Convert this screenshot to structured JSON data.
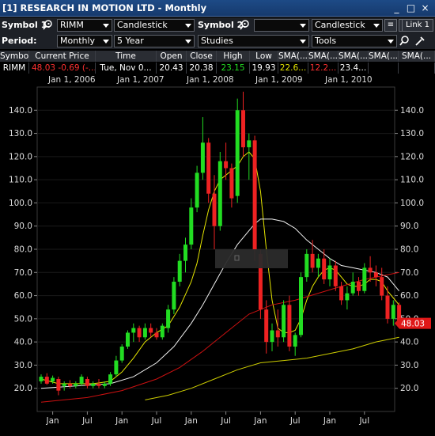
{
  "window": {
    "title": "[1] RESEARCH IN MOTION LTD - Monthly",
    "minimize_icon": "_",
    "restore_icon": "□",
    "close_icon": "×"
  },
  "toolbar": {
    "symbol1_label": "Symbol 1:",
    "symbol1_value": "RIMM",
    "chart_type1": "Candlestick",
    "symbol2_label": "Symbol 2:",
    "symbol2_value": "",
    "chart_type2": "Candlestick",
    "help_label": "?",
    "link_label": "Link 1",
    "period_label": "Period:",
    "period_value": "Monthly",
    "range_value": "5 Year",
    "studies_value": "Studies",
    "tools_value": "Tools"
  },
  "quote_table": {
    "headers": [
      "Symbol",
      "Current Price",
      "Time",
      "Open",
      "Close",
      "High",
      "Low",
      "SMA(...",
      "SMA(...",
      "SMA(...",
      "SMA(...",
      "SMA(..."
    ],
    "row": {
      "symbol": "RIMM",
      "price": "48.03",
      "change": "-0.69",
      "pct": "(-...",
      "time": "Tue, Nov 0...",
      "open": "20.43",
      "close": "20.38",
      "high": "23.15",
      "low": "19.93",
      "sma1": "22.6...",
      "sma2": "12.2...",
      "sma3": "23.4..."
    }
  },
  "colors": {
    "up": "#22dd22",
    "down": "#ee2222",
    "sma_yellow": "#e6e600",
    "sma_white": "#f0f0f0",
    "sma_red": "#cc1111",
    "sma_olive": "#cccc00",
    "price_badge": "#e01818"
  },
  "date_labels": [
    "Jan 1, 2006",
    "Jan 1, 2007",
    "Jan 1, 2008",
    "Jan 1, 2009",
    "Jan 1, 2010"
  ],
  "x_tick_labels": [
    "Jan",
    "Jul",
    "Jan",
    "Jul",
    "Jan",
    "Jul",
    "Jan",
    "Jul",
    "Jan",
    "Jul"
  ],
  "chart_data": {
    "type": "candlestick",
    "period": "Monthly",
    "ylim": [
      10,
      150
    ],
    "y_ticks": [
      20,
      30,
      40,
      50,
      60,
      70,
      80,
      90,
      100,
      110,
      120,
      130,
      140
    ],
    "y_tick_labels": [
      "20.0",
      "30.0",
      "40.0",
      "50.0",
      "60.0",
      "70.0",
      "80.0",
      "90.0",
      "100.0",
      "110.0",
      "120.0",
      "130.0",
      "140.0"
    ],
    "last_price_label": "48.03",
    "last_price": 48.03,
    "start_month": "2005-11",
    "candles": [
      {
        "o": 23.0,
        "h": 26.0,
        "l": 22.0,
        "c": 25.0
      },
      {
        "o": 25.0,
        "h": 26.5,
        "l": 21.5,
        "c": 22.0
      },
      {
        "o": 23.0,
        "h": 25.5,
        "l": 22.0,
        "c": 24.5
      },
      {
        "o": 24.0,
        "h": 25.0,
        "l": 17.0,
        "c": 19.0
      },
      {
        "o": 21.0,
        "h": 23.0,
        "l": 19.0,
        "c": 22.0
      },
      {
        "o": 22.0,
        "h": 23.5,
        "l": 20.0,
        "c": 21.0
      },
      {
        "o": 21.0,
        "h": 23.0,
        "l": 20.0,
        "c": 22.0
      },
      {
        "o": 22.0,
        "h": 26.0,
        "l": 21.0,
        "c": 25.0
      },
      {
        "o": 24.0,
        "h": 25.0,
        "l": 20.0,
        "c": 21.0
      },
      {
        "o": 21.0,
        "h": 23.0,
        "l": 20.0,
        "c": 22.0
      },
      {
        "o": 22.0,
        "h": 24.0,
        "l": 20.0,
        "c": 21.0
      },
      {
        "o": 21.0,
        "h": 23.0,
        "l": 20.0,
        "c": 22.0
      },
      {
        "o": 22.0,
        "h": 27.0,
        "l": 21.0,
        "c": 26.0
      },
      {
        "o": 26.0,
        "h": 34.0,
        "l": 25.0,
        "c": 32.0
      },
      {
        "o": 32.0,
        "h": 39.0,
        "l": 31.0,
        "c": 38.0
      },
      {
        "o": 38.0,
        "h": 45.0,
        "l": 37.0,
        "c": 44.0
      },
      {
        "o": 44.0,
        "h": 48.0,
        "l": 40.0,
        "c": 46.0
      },
      {
        "o": 46.0,
        "h": 47.0,
        "l": 40.0,
        "c": 42.0
      },
      {
        "o": 42.0,
        "h": 48.0,
        "l": 41.0,
        "c": 46.0
      },
      {
        "o": 46.0,
        "h": 48.0,
        "l": 42.0,
        "c": 44.0
      },
      {
        "o": 44.0,
        "h": 46.0,
        "l": 41.0,
        "c": 42.0
      },
      {
        "o": 42.0,
        "h": 48.0,
        "l": 41.0,
        "c": 47.0
      },
      {
        "o": 46.0,
        "h": 56.0,
        "l": 44.0,
        "c": 54.0
      },
      {
        "o": 54.0,
        "h": 68.0,
        "l": 52.0,
        "c": 66.0
      },
      {
        "o": 66.0,
        "h": 78.0,
        "l": 64.0,
        "c": 75.0
      },
      {
        "o": 75.0,
        "h": 85.0,
        "l": 70.0,
        "c": 82.0
      },
      {
        "o": 82.0,
        "h": 102.0,
        "l": 80.0,
        "c": 98.0
      },
      {
        "o": 98.0,
        "h": 116.0,
        "l": 96.0,
        "c": 113.0
      },
      {
        "o": 113.0,
        "h": 137.0,
        "l": 110.0,
        "c": 126.0
      },
      {
        "o": 126.0,
        "h": 128.0,
        "l": 100.0,
        "c": 104.0
      },
      {
        "o": 104.0,
        "h": 112.0,
        "l": 80.0,
        "c": 90.0
      },
      {
        "o": 90.0,
        "h": 122.0,
        "l": 88.0,
        "c": 118.0
      },
      {
        "o": 118.0,
        "h": 126.0,
        "l": 110.0,
        "c": 115.0
      },
      {
        "o": 115.0,
        "h": 117.0,
        "l": 98.0,
        "c": 102.0
      },
      {
        "o": 103.0,
        "h": 145.0,
        "l": 100.0,
        "c": 140.0
      },
      {
        "o": 140.0,
        "h": 148.0,
        "l": 120.0,
        "c": 124.0
      },
      {
        "o": 124.0,
        "h": 130.0,
        "l": 110.0,
        "c": 127.0
      },
      {
        "o": 127.0,
        "h": 129.0,
        "l": 75.0,
        "c": 80.0
      },
      {
        "o": 78.0,
        "h": 80.0,
        "l": 50.0,
        "c": 54.0
      },
      {
        "o": 54.0,
        "h": 58.0,
        "l": 35.0,
        "c": 40.0
      },
      {
        "o": 40.0,
        "h": 48.0,
        "l": 36.0,
        "c": 45.0
      },
      {
        "o": 45.0,
        "h": 54.0,
        "l": 38.0,
        "c": 42.0
      },
      {
        "o": 42.0,
        "h": 58.0,
        "l": 40.0,
        "c": 56.0
      },
      {
        "o": 56.0,
        "h": 60.0,
        "l": 36.0,
        "c": 38.0
      },
      {
        "o": 38.0,
        "h": 44.0,
        "l": 34.0,
        "c": 43.0
      },
      {
        "o": 43.0,
        "h": 70.0,
        "l": 42.0,
        "c": 68.0
      },
      {
        "o": 68.0,
        "h": 80.0,
        "l": 66.0,
        "c": 78.0
      },
      {
        "o": 78.0,
        "h": 84.0,
        "l": 70.0,
        "c": 72.0
      },
      {
        "o": 72.0,
        "h": 78.0,
        "l": 68.0,
        "c": 76.0
      },
      {
        "o": 76.0,
        "h": 80.0,
        "l": 65.0,
        "c": 67.0
      },
      {
        "o": 67.0,
        "h": 76.0,
        "l": 64.0,
        "c": 73.0
      },
      {
        "o": 73.0,
        "h": 75.0,
        "l": 62.0,
        "c": 64.0
      },
      {
        "o": 64.0,
        "h": 66.0,
        "l": 56.0,
        "c": 58.0
      },
      {
        "o": 58.0,
        "h": 64.0,
        "l": 54.0,
        "c": 61.0
      },
      {
        "o": 61.0,
        "h": 70.0,
        "l": 60.0,
        "c": 66.0
      },
      {
        "o": 66.0,
        "h": 68.0,
        "l": 60.0,
        "c": 62.0
      },
      {
        "o": 62.0,
        "h": 74.0,
        "l": 61.0,
        "c": 72.0
      },
      {
        "o": 72.0,
        "h": 77.0,
        "l": 66.0,
        "c": 70.0
      },
      {
        "o": 70.0,
        "h": 73.0,
        "l": 64.0,
        "c": 68.0
      },
      {
        "o": 68.0,
        "h": 72.0,
        "l": 58.0,
        "c": 60.0
      },
      {
        "o": 60.0,
        "h": 64.0,
        "l": 48.0,
        "c": 50.0
      },
      {
        "o": 50.0,
        "h": 58.0,
        "l": 47.0,
        "c": 56.0
      },
      {
        "o": 56.0,
        "h": 57.0,
        "l": 46.0,
        "c": 48.0
      }
    ],
    "sma_series": [
      {
        "color": "#e6e600",
        "points": [
          [
            0,
            24
          ],
          [
            3,
            22
          ],
          [
            6,
            22
          ],
          [
            9,
            22
          ],
          [
            12,
            23
          ],
          [
            14,
            27
          ],
          [
            16,
            33
          ],
          [
            18,
            40
          ],
          [
            20,
            44
          ],
          [
            22,
            47
          ],
          [
            24,
            55
          ],
          [
            26,
            66
          ],
          [
            27,
            74
          ],
          [
            28,
            86
          ],
          [
            29,
            97
          ],
          [
            30,
            105
          ],
          [
            31,
            110
          ],
          [
            32,
            112
          ],
          [
            33,
            114
          ],
          [
            34,
            116
          ],
          [
            35,
            120
          ],
          [
            36,
            122
          ],
          [
            37,
            119
          ],
          [
            38,
            105
          ],
          [
            39,
            80
          ],
          [
            40,
            58
          ],
          [
            41,
            46
          ],
          [
            42,
            44
          ],
          [
            43,
            44
          ],
          [
            44,
            45
          ],
          [
            45,
            50
          ],
          [
            46,
            58
          ],
          [
            47,
            64
          ],
          [
            48,
            68
          ],
          [
            49,
            71
          ],
          [
            50,
            72
          ],
          [
            51,
            71
          ],
          [
            52,
            68
          ],
          [
            53,
            65
          ],
          [
            54,
            64
          ],
          [
            55,
            64
          ],
          [
            56,
            65
          ],
          [
            57,
            67
          ],
          [
            58,
            67
          ],
          [
            59,
            66
          ],
          [
            60,
            62
          ],
          [
            61,
            59
          ],
          [
            62,
            56
          ]
        ]
      },
      {
        "color": "#f0f0f0",
        "points": [
          [
            0,
            20
          ],
          [
            6,
            21
          ],
          [
            12,
            22
          ],
          [
            16,
            25
          ],
          [
            20,
            31
          ],
          [
            23,
            38
          ],
          [
            26,
            48
          ],
          [
            28,
            56
          ],
          [
            30,
            65
          ],
          [
            32,
            74
          ],
          [
            34,
            82
          ],
          [
            36,
            88
          ],
          [
            37,
            91
          ],
          [
            38,
            93
          ],
          [
            40,
            93
          ],
          [
            42,
            92
          ],
          [
            44,
            89
          ],
          [
            46,
            84
          ],
          [
            48,
            80
          ],
          [
            50,
            76
          ],
          [
            52,
            73
          ],
          [
            54,
            72
          ],
          [
            56,
            71
          ],
          [
            58,
            70
          ],
          [
            60,
            68
          ],
          [
            62,
            62
          ]
        ]
      },
      {
        "color": "#cc1111",
        "points": [
          [
            0,
            14
          ],
          [
            8,
            16
          ],
          [
            14,
            19
          ],
          [
            20,
            24
          ],
          [
            24,
            29
          ],
          [
            28,
            36
          ],
          [
            32,
            44
          ],
          [
            36,
            52
          ],
          [
            40,
            56
          ],
          [
            44,
            58
          ],
          [
            48,
            61
          ],
          [
            52,
            64
          ],
          [
            56,
            67
          ],
          [
            60,
            69
          ],
          [
            62,
            70
          ]
        ]
      },
      {
        "color": "#cccc00",
        "points": [
          [
            18,
            15
          ],
          [
            22,
            17
          ],
          [
            26,
            20
          ],
          [
            30,
            24
          ],
          [
            34,
            28
          ],
          [
            38,
            31
          ],
          [
            42,
            32
          ],
          [
            46,
            33
          ],
          [
            50,
            35
          ],
          [
            54,
            37
          ],
          [
            58,
            40
          ],
          [
            62,
            42
          ]
        ]
      }
    ]
  }
}
